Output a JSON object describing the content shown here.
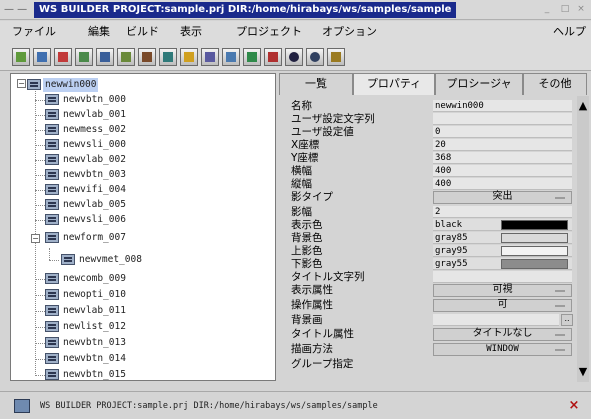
{
  "window": {
    "title": "WS BUILDER PROJECT:sample.prj DIR:/home/hirabays/ws/samples/sample",
    "sysmenu": "— —",
    "minimize": "_",
    "maximize": "□",
    "close": "×"
  },
  "menu": {
    "file": "ファイル",
    "edit": "編集",
    "build": "ビルド",
    "view": "表示",
    "project": "プロジェクト",
    "option": "オプション",
    "help": "ヘルプ"
  },
  "toolbar": {
    "icons": [
      "new-window-icon",
      "new-button-icon",
      "new-label-icon",
      "new-list-icon",
      "new-field-icon",
      "new-form-icon",
      "new-menu-icon",
      "new-dialog-icon",
      "edit-icon",
      "properties-icon",
      "document-icon",
      "save-icon",
      "cut-icon",
      "zoom-in-icon",
      "zoom-out-icon",
      "build-icon"
    ]
  },
  "tree": {
    "root": "newwin000",
    "items": [
      "newvbtn_000",
      "newvlab_001",
      "newmess_002",
      "newvsli_000",
      "newvlab_002",
      "newvbtn_003",
      "newvifi_004",
      "newvlab_005",
      "newvsli_006",
      "newform_007",
      "newvmet_008",
      "newcomb_009",
      "newopti_010",
      "newvlab_011",
      "newlist_012",
      "newvbtn_013",
      "newvbtn_014",
      "newvbtn_015"
    ]
  },
  "tabs": {
    "list": "一覧",
    "properties": "プロパティ",
    "procedure": "プロシージャ",
    "other": "その他"
  },
  "properties": [
    {
      "label": "名称",
      "value": "newwin000"
    },
    {
      "label": "ユーザ設定文字列",
      "value": ""
    },
    {
      "label": "ユーザ設定値",
      "value": "0"
    },
    {
      "label": "X座標",
      "value": "20"
    },
    {
      "label": "Y座標",
      "value": "368"
    },
    {
      "label": "横幅",
      "value": "400"
    },
    {
      "label": "縦幅",
      "value": "400"
    },
    {
      "label": "影タイプ",
      "value": "突出"
    },
    {
      "label": "影幅",
      "value": "2"
    },
    {
      "label": "表示色",
      "value": "black"
    },
    {
      "label": "背景色",
      "value": "gray85"
    },
    {
      "label": "上影色",
      "value": "gray95"
    },
    {
      "label": "下影色",
      "value": "gray55"
    },
    {
      "label": "タイトル文字列",
      "value": ""
    },
    {
      "label": "表示属性",
      "value": "可視"
    },
    {
      "label": "操作属性",
      "value": "可"
    },
    {
      "label": "背景画",
      "value": ""
    },
    {
      "label": "タイトル属性",
      "value": "タイトルなし"
    },
    {
      "label": "描画方法",
      "value": "WINDOW"
    },
    {
      "label": "グループ指定",
      "value": ""
    }
  ],
  "colors": {
    "black": "#000000",
    "gray85": "#d9d9d9",
    "gray95": "#f2f2f2",
    "gray55": "#8c8c8c",
    "title_active": "#1a2a8c"
  },
  "status": {
    "text": "WS BUILDER PROJECT:sample.prj DIR:/home/hirabays/ws/samples/sample",
    "close": "×"
  }
}
